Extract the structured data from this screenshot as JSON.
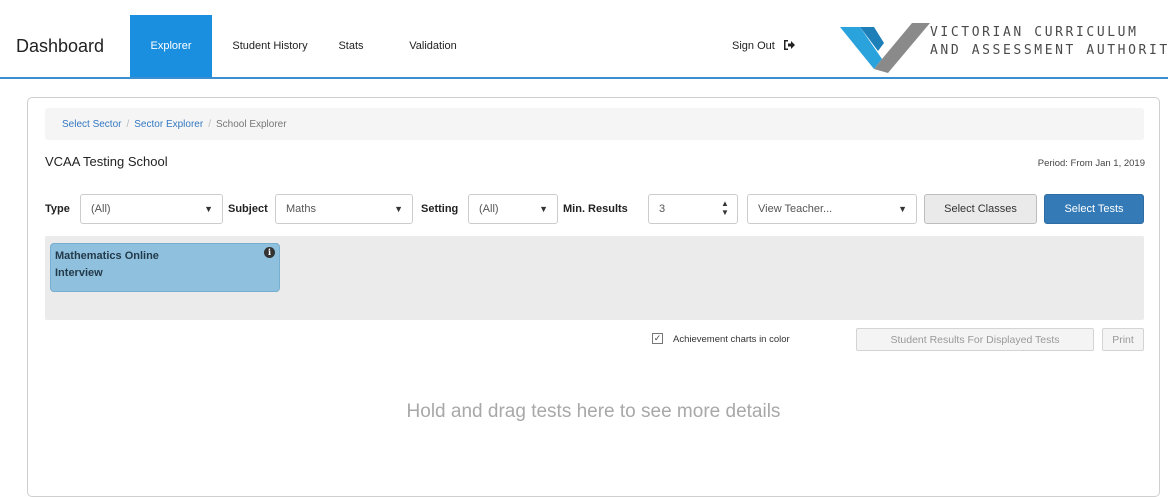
{
  "nav": {
    "brand": "Dashboard",
    "items": [
      {
        "label": "Explorer",
        "active": true
      },
      {
        "label": "Student History"
      },
      {
        "label": "Stats"
      },
      {
        "label": "Validation"
      }
    ],
    "sign_out": "Sign Out",
    "sign_out_icon": "sign-out-icon",
    "logo_line1": "VICTORIAN CURRICULUM",
    "logo_line2": "AND ASSESSMENT AUTHORITY"
  },
  "breadcrumb": {
    "items": [
      "Select Sector",
      "Sector Explorer",
      "School Explorer"
    ],
    "separator": "/"
  },
  "school": {
    "title": "VCAA Testing School",
    "period": "Period: From Jan 1, 2019"
  },
  "filters": {
    "type_label": "Type",
    "type_value": "(All)",
    "subject_label": "Subject",
    "subject_value": "Maths",
    "setting_label": "Setting",
    "setting_value": "(All)",
    "min_results_label": "Min. Results",
    "min_results_value": "3",
    "teacher_value": "View Teacher...",
    "select_classes": "Select Classes",
    "select_tests": "Select Tests"
  },
  "tests": [
    {
      "name": "Mathematics Online Interview",
      "icon": "info-icon"
    }
  ],
  "options": {
    "color_charts_label": "Achievement charts in color",
    "color_charts_checked": true,
    "student_results_button": "Student Results For Displayed Tests",
    "print_button": "Print"
  },
  "drop_hint": "Hold and drag tests here to see more details",
  "colors": {
    "accent": "#1a8fe0",
    "primary_button": "#337ab7",
    "test_card": "#8fc0dd",
    "logo_blue": "#2aa3dd",
    "logo_grey": "#8a8a8a"
  }
}
